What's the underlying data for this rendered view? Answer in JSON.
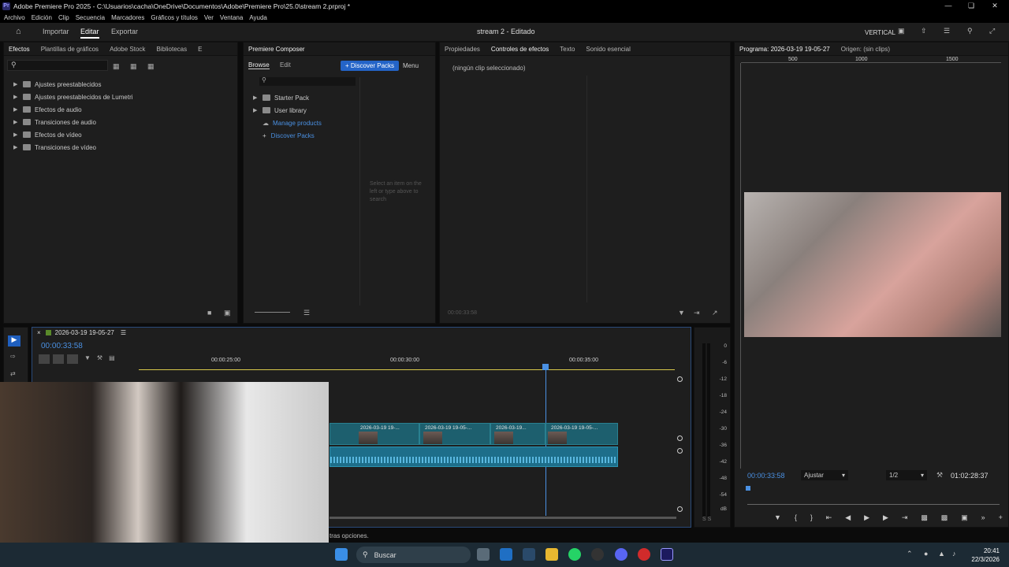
{
  "window": {
    "title": "Adobe Premiere Pro 2025 - C:\\Usuarios\\cacha\\OneDrive\\Documentos\\Adobe\\Premiere Pro\\25.0\\stream 2.prproj *",
    "logo": "Pr"
  },
  "menu": [
    "Archivo",
    "Edición",
    "Clip",
    "Secuencia",
    "Marcadores",
    "Gráficos y títulos",
    "Ver",
    "Ventana",
    "Ayuda"
  ],
  "workspace": {
    "import": "Importar",
    "edit": "Editar",
    "export": "Exportar",
    "project_title": "stream 2 - Editado",
    "mode": "VERTICAL"
  },
  "effects_panel": {
    "tabs": [
      "Efectos",
      "Plantillas de gráficos",
      "Adobe Stock",
      "Bibliotecas",
      "E"
    ],
    "items": [
      "Ajustes preestablecidos",
      "Ajustes preestablecidos de Lumetri",
      "Efectos de audio",
      "Transiciones de audio",
      "Efectos de vídeo",
      "Transiciones de vídeo"
    ]
  },
  "composer_panel": {
    "title": "Premiere Composer",
    "browse": "Browse",
    "edit": "Edit",
    "discover_button": "+ Discover Packs",
    "menu": "Menu",
    "items": [
      "Starter Pack",
      "User library",
      "Manage products",
      "Discover Packs"
    ],
    "hint": "Select an item on the left or type above to search"
  },
  "effect_controls": {
    "tabs": [
      "Propiedades",
      "Controles de efectos",
      "Texto",
      "Sonido esencial"
    ],
    "empty": "(ningún clip seleccionado)",
    "timecode": "00:00:33:58"
  },
  "program_monitor": {
    "title": "Programa: 2026-03-19 19-05-27",
    "source": "Origen: (sin clips)",
    "ruler": [
      "500",
      "1000",
      "1500"
    ],
    "timecode": "00:00:33:58",
    "fit": "Ajustar",
    "quality": "1/2",
    "duration": "01:02:28:37"
  },
  "timeline": {
    "sequence": "2026-03-19 19-05-27",
    "timecode": "00:00:33:58",
    "ruler": [
      "00:00:25:00",
      "00:00:30:00",
      "00:00:35:00"
    ],
    "clips": [
      "2026-03-19 19-...",
      "2026-03-19 19-05-...",
      "2026-03-19...",
      "2026-03-19 19-05-..."
    ],
    "status": "tras opciones."
  },
  "meter": {
    "labels": [
      "0",
      "-6",
      "-12",
      "-18",
      "-24",
      "-30",
      "-36",
      "-42",
      "-48",
      "-54",
      "dB"
    ],
    "solo": "S S"
  },
  "taskbar": {
    "search": "Buscar",
    "time": "20:41",
    "date": "22/3/2026"
  },
  "colors": {
    "accent": "#2464c8",
    "clip_video": "#1d5f6e",
    "clip_audio": "#1d6e8a",
    "timecode": "#4a90e2"
  }
}
